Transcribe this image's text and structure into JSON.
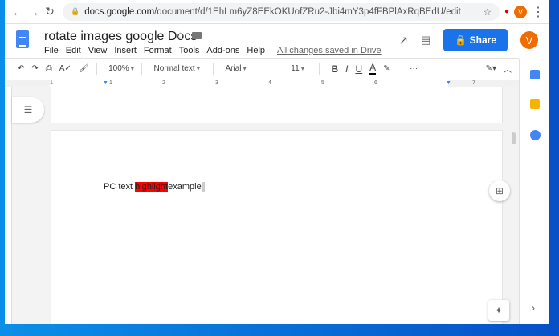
{
  "browser": {
    "url_host": "docs.google.com",
    "url_path": "/document/d/1EhLm6yZ8EEkOKUofZRu2-Jbi4mY3p4fFBPlAxRqBEdU/edit",
    "profile": "V"
  },
  "header": {
    "title": "rotate images google Docs",
    "menu": [
      "File",
      "Edit",
      "View",
      "Insert",
      "Format",
      "Tools",
      "Add-ons",
      "Help"
    ],
    "saved_status": "All changes saved in Drive",
    "share_label": "Share",
    "avatar": "V"
  },
  "toolbar": {
    "zoom": "100%",
    "style": "Normal text",
    "font": "Arial",
    "size": "11",
    "bold": "B",
    "italic": "I",
    "underline": "U",
    "text_color": "A",
    "more": "···"
  },
  "ruler": [
    "1",
    "1",
    "2",
    "3",
    "4",
    "5",
    "6",
    "7"
  ],
  "document": {
    "before": "PC text ",
    "highlight": "highlight",
    "after": "example"
  },
  "colors": {
    "highlight": "#ff0000",
    "share": "#1a73e8",
    "avatar": "#ef6c00"
  }
}
